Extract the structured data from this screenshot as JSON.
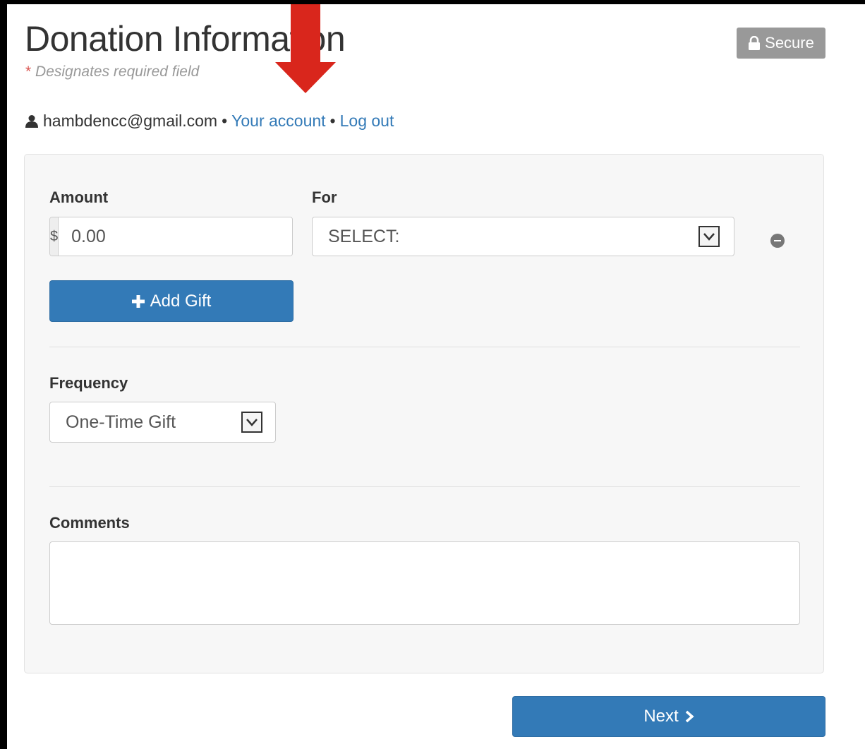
{
  "header": {
    "title": "Donation Information",
    "required_star": "*",
    "required_note": "Designates required field",
    "secure_label": "Secure"
  },
  "user": {
    "email": "hambdencc@gmail.com",
    "separator": "•",
    "account_link": "Your account",
    "logout_link": "Log out"
  },
  "gift": {
    "amount_label": "Amount",
    "currency_symbol": "$",
    "amount_value": "0.00",
    "for_label": "For",
    "for_selected": "SELECT:",
    "add_gift_label": "Add Gift"
  },
  "frequency": {
    "label": "Frequency",
    "selected": "One-Time Gift"
  },
  "comments": {
    "label": "Comments",
    "value": ""
  },
  "footer": {
    "next_label": "Next"
  },
  "colors": {
    "primary": "#337ab7",
    "annotation_arrow": "#d9261c",
    "secure_badge": "#999999"
  },
  "icons": [
    "user-icon",
    "lock-icon",
    "plus-icon",
    "chevron-right-icon",
    "remove-icon",
    "chevron-down-icon",
    "red-arrow-annotation"
  ]
}
